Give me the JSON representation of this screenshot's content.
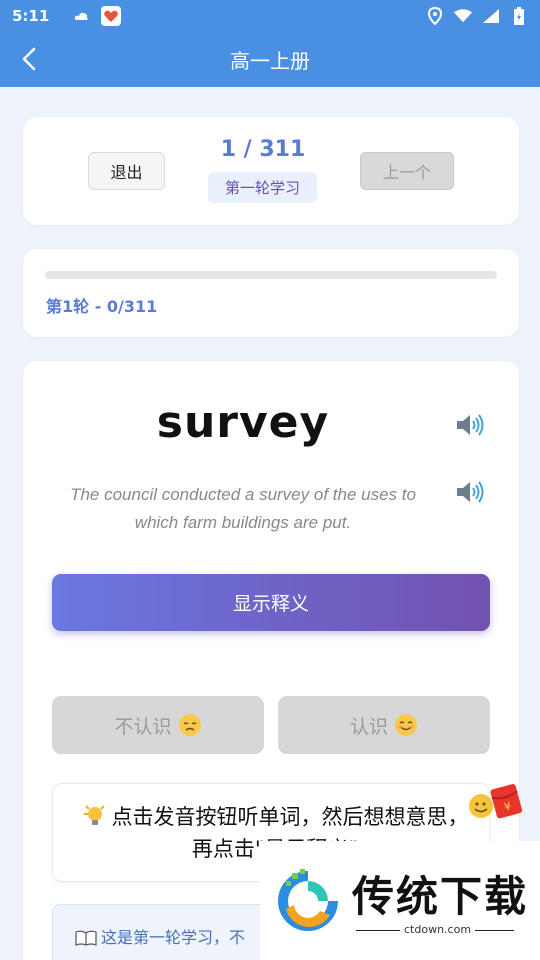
{
  "status_bar": {
    "time": "5:11"
  },
  "header": {
    "title": "高一上册"
  },
  "controls": {
    "exit_label": "退出",
    "counter": "1 / 311",
    "round_badge": "第一轮学习",
    "prev_label": "上一个"
  },
  "progress": {
    "fraction": 0,
    "label": "第1轮 - 0/311"
  },
  "card": {
    "word": "survey",
    "sentence": "The council conducted a survey of the uses to which farm buildings are put.",
    "show_meaning_label": "显示释义",
    "unknown_label": "不认识",
    "known_label": "认识",
    "tip": "点击发音按钮听单词，然后想想意思，再点击\"显示释义\"",
    "info": "这是第一轮学习，不"
  },
  "watermark": {
    "brand": "传统下载",
    "url": "ctdown.com"
  },
  "colors": {
    "primary": "#4a90e2",
    "accent": "#5b7bd5",
    "gradient_start": "#6a78e0",
    "gradient_end": "#7251b0"
  },
  "icons": [
    "back-arrow-icon",
    "speaker-icon",
    "lightbulb-icon",
    "book-icon",
    "red-packet-icon"
  ]
}
